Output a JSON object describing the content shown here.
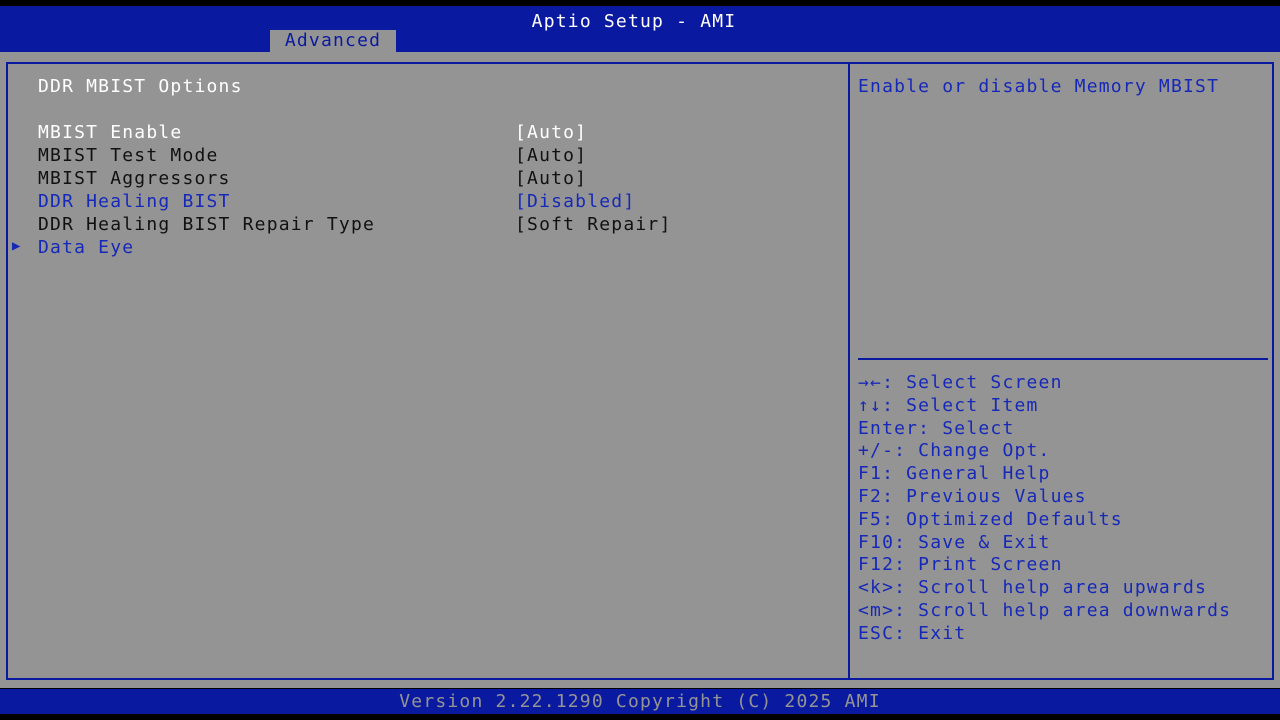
{
  "header": {
    "title": "Aptio Setup - AMI",
    "tabs": [
      {
        "label": "Advanced",
        "active": true
      }
    ]
  },
  "main": {
    "section_title": "DDR MBIST Options",
    "settings": [
      {
        "label": "MBIST Enable",
        "value": "[Auto]",
        "state": "selected"
      },
      {
        "label": "MBIST Test Mode",
        "value": "[Auto]",
        "state": "normal"
      },
      {
        "label": "MBIST Aggressors",
        "value": "[Auto]",
        "state": "normal"
      },
      {
        "label": "DDR Healing BIST",
        "value": "[Disabled]",
        "state": "editable"
      },
      {
        "label": "DDR Healing BIST Repair Type",
        "value": "[Soft Repair]",
        "state": "normal"
      }
    ],
    "submenus": [
      {
        "label": "Data Eye",
        "icon": "right-triangle-icon"
      }
    ]
  },
  "help": {
    "description": "Enable or disable Memory MBIST",
    "keys": [
      "→←: Select Screen",
      "↑↓: Select Item",
      "Enter: Select",
      "+/-: Change Opt.",
      "F1: General Help",
      "F2: Previous Values",
      "F5: Optimized Defaults",
      "F10: Save & Exit",
      "F12: Print Screen",
      "<k>: Scroll help area upwards",
      "<m>: Scroll help area downwards",
      "ESC: Exit"
    ]
  },
  "footer": {
    "version": "Version 2.22.1290 Copyright (C) 2025 AMI"
  },
  "colors": {
    "frame_blue": "#0a1aa0",
    "panel_gray": "#949494",
    "text_blue": "#1628b8",
    "text_white": "#ffffff",
    "text_black": "#111111"
  }
}
